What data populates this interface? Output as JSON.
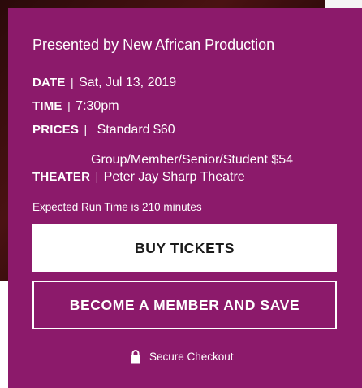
{
  "event": {
    "presented_by": "Presented by New African Production",
    "date_label": "DATE",
    "date_value": "Sat, Jul 13, 2019",
    "time_label": "TIME",
    "time_value": "7:30pm",
    "prices_label": "PRICES",
    "prices": [
      "Standard $60",
      "Group/Member/Senior/Student $54"
    ],
    "theater_label": "THEATER",
    "theater_value": "Peter Jay Sharp Theatre",
    "separator": "|",
    "run_time": "Expected Run Time is 210 minutes"
  },
  "actions": {
    "buy_label": "BUY TICKETS",
    "member_label": "BECOME A MEMBER AND SAVE",
    "secure_label": "Secure Checkout"
  },
  "colors": {
    "panel": "#8c1a6b",
    "text": "#ffffff",
    "buy_button_bg": "#ffffff",
    "buy_button_text": "#1a1a1a"
  },
  "icons": {
    "secure": "lock-icon"
  }
}
